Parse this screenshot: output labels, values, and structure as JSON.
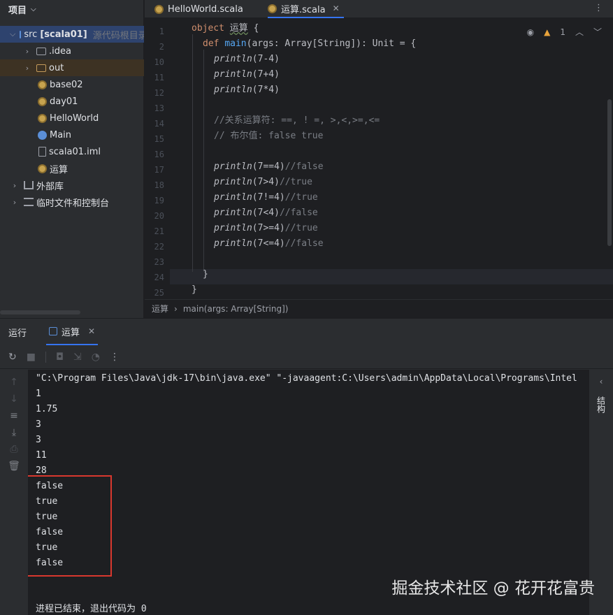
{
  "project": {
    "title": "项目",
    "tree": [
      {
        "label": "src",
        "extra": "[scala01]",
        "hint": "源代码根目录",
        "kind": "src"
      },
      {
        "label": ".idea",
        "kind": "folder"
      },
      {
        "label": "out",
        "kind": "folder"
      },
      {
        "label": "base02",
        "kind": "scala"
      },
      {
        "label": "day01",
        "kind": "scala"
      },
      {
        "label": "HelloWorld",
        "kind": "scala"
      },
      {
        "label": "Main",
        "kind": "main"
      },
      {
        "label": "scala01.iml",
        "kind": "file"
      },
      {
        "label": "运算",
        "kind": "scala"
      },
      {
        "label": "外部库",
        "kind": "lib"
      },
      {
        "label": "临时文件和控制台",
        "kind": "scratch"
      }
    ]
  },
  "tabs": [
    {
      "label": "HelloWorld.scala",
      "active": false
    },
    {
      "label": "运算.scala",
      "active": true
    }
  ],
  "editor": {
    "warning_count": "1",
    "line_numbers": [
      "1",
      "2",
      "10",
      "11",
      "12",
      "13",
      "14",
      "15",
      "16",
      "17",
      "18",
      "19",
      "20",
      "21",
      "22",
      "23",
      "24",
      "25"
    ],
    "lines": [
      {
        "kw": "object",
        "name": "运算",
        "rest": " {"
      },
      {
        "kw": "def",
        "fn": "main",
        "rest": "(args: Array[String]): Unit = {"
      },
      {
        "call": "println",
        "args": "(7-4)"
      },
      {
        "call": "println",
        "args": "(7+4)"
      },
      {
        "call": "println",
        "args": "(7*4)"
      },
      {
        "text": ""
      },
      {
        "comment": "//关系运算符: ==, ! =, >,<,>=,<="
      },
      {
        "comment": "// 布尔值: false true"
      },
      {
        "text": ""
      },
      {
        "call": "println",
        "args": "(7==4)",
        "comment": "//false"
      },
      {
        "call": "println",
        "args": "(7>4)",
        "comment": "//true"
      },
      {
        "call": "println",
        "args": "(7!=4)",
        "comment": "//true"
      },
      {
        "call": "println",
        "args": "(7<4)",
        "comment": "//false"
      },
      {
        "call": "println",
        "args": "(7>=4)",
        "comment": "//true"
      },
      {
        "call": "println",
        "args": "(7<=4)",
        "comment": "//false"
      },
      {
        "text": ""
      },
      {
        "text": "}"
      },
      {
        "text": "}"
      }
    ]
  },
  "breadcrumb": {
    "items": [
      "运算",
      "main(args: Array[String])"
    ]
  },
  "run": {
    "title": "运行",
    "tab_label": "运算",
    "right_rail_label": "结构",
    "console": [
      "\"C:\\Program Files\\Java\\jdk-17\\bin\\java.exe\" \"-javaagent:C:\\Users\\admin\\AppData\\Local\\Programs\\Intel",
      "1",
      "1.75",
      "3",
      "3",
      "11",
      "28",
      "false",
      "true",
      "true",
      "false",
      "true",
      "false",
      "",
      "进程已结束，退出代码为 0"
    ]
  },
  "watermark": "掘金技术社区 @ 花开花富贵",
  "colors": {
    "keyword": "#cf8e6d",
    "function": "#56a8f5",
    "comment": "#7a7e85",
    "highlight_box": "#d9382e",
    "accent": "#3574f0"
  }
}
